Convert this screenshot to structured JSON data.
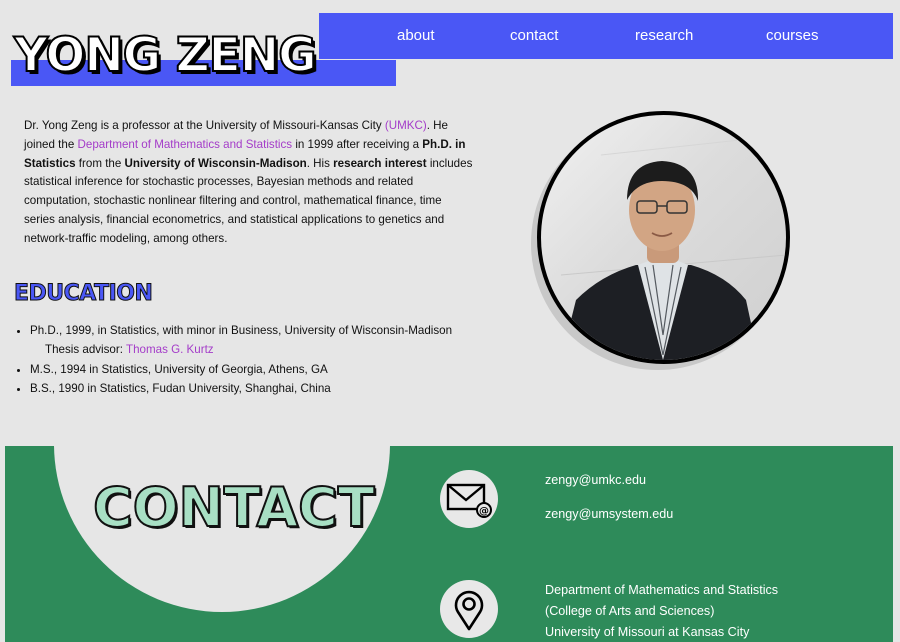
{
  "header": {
    "name": "YONG ZENG",
    "nav": [
      {
        "label": "about"
      },
      {
        "label": "contact"
      },
      {
        "label": "research"
      },
      {
        "label": "courses"
      }
    ]
  },
  "bio": {
    "p1": "Dr. Yong Zeng is a professor at the University of Missouri-Kansas City ",
    "umkc": "(UMKC)",
    "p2": ". He joined the ",
    "dept": "Department of Mathematics and Statistics",
    "p3": " in 1999 after receiving a ",
    "phd": "Ph.D. in Statistics",
    "p4": " from the ",
    "uw": "University of Wisconsin-Madison",
    "p5": ". His ",
    "ri": "research interest",
    "p6": " includes statistical inference for stochastic processes, Bayesian methods and related computation, stochastic nonlinear filtering and control, mathematical finance, time series analysis, financial econometrics, and statistical applications to genetics and network-traffic modeling, among others."
  },
  "education": {
    "title": "EDUCATION",
    "items": [
      {
        "text": "Ph.D., 1999, in Statistics, with minor in Business, University of Wisconsin-Madison",
        "advisor_prefix": "Thesis advisor: ",
        "advisor": "Thomas G. Kurtz"
      },
      {
        "text": "M.S., 1994 in Statistics, University of Georgia, Athens, GA"
      },
      {
        "text": "B.S., 1990 in Statistics, Fudan University, Shanghai, China"
      }
    ]
  },
  "contact": {
    "title": "CONTACT",
    "email1": "zengy@umkc.edu",
    "email2": "zengy@umsystem.edu",
    "address": [
      "Department of Mathematics and Statistics",
      "(College of Arts and Sciences)",
      "University of Missouri at Kansas City"
    ]
  },
  "colors": {
    "accent": "#4a57f5",
    "link": "#a43cc9",
    "contact_bg": "#2e8b5a",
    "contact_title": "#a8dfc4"
  },
  "icons": [
    "email-icon",
    "location-pin-icon"
  ]
}
